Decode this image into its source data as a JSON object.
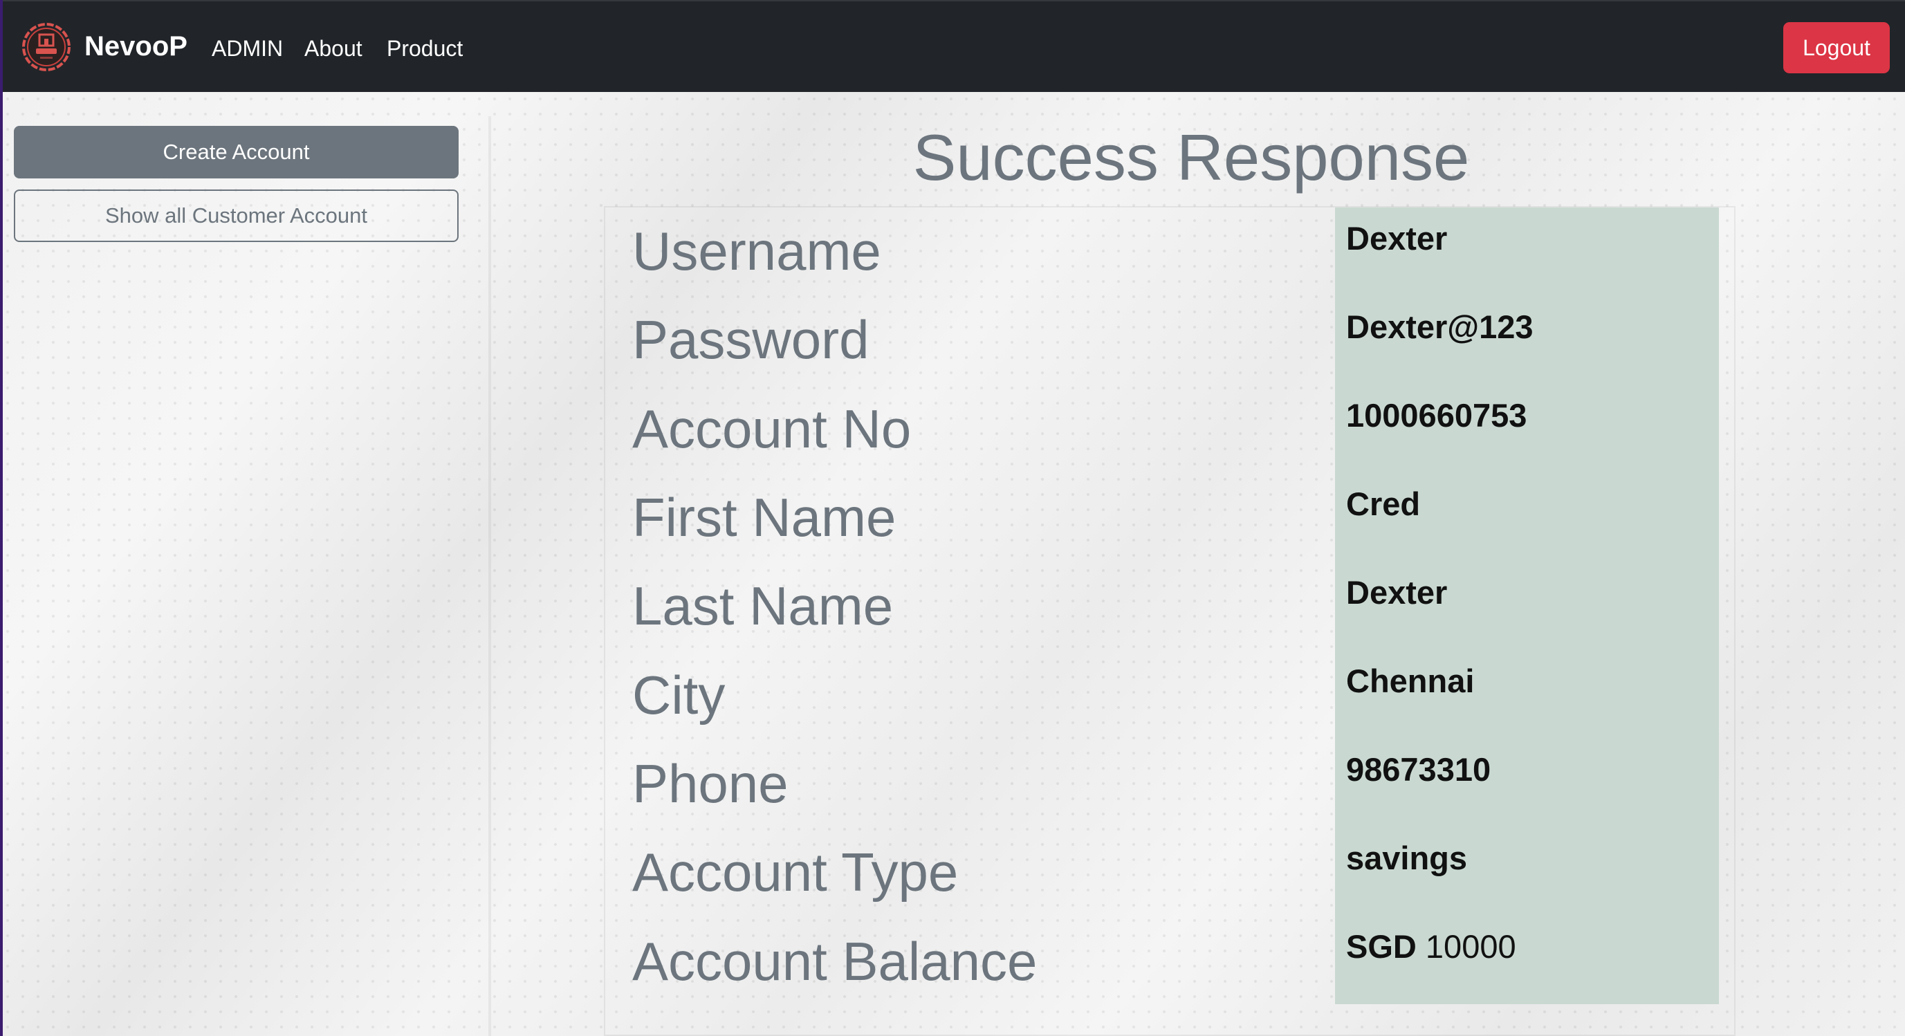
{
  "navbar": {
    "brand": "NevooP",
    "links": [
      "ADMIN",
      "About",
      "Product"
    ],
    "logout_label": "Logout",
    "logo_icon": "nevoop-logo-icon"
  },
  "sidebar": {
    "create_label": "Create Account",
    "show_label": "Show all Customer Account"
  },
  "main": {
    "title": "Success Response",
    "rows": [
      {
        "label": "Username",
        "value": "Dexter"
      },
      {
        "label": "Password",
        "value": "Dexter@123"
      },
      {
        "label": "Account No",
        "value": "1000660753"
      },
      {
        "label": "First Name",
        "value": "Cred"
      },
      {
        "label": "Last Name",
        "value": "Dexter"
      },
      {
        "label": "City",
        "value": "Chennai"
      },
      {
        "label": "Phone",
        "value": "98673310"
      },
      {
        "label": "Account Type",
        "value": "savings"
      },
      {
        "label": "Account Balance",
        "currency": "SGD",
        "value": "10000"
      }
    ]
  },
  "colors": {
    "navbar_bg": "#212529",
    "logout_bg": "#dc3545",
    "secondary": "#6c757d",
    "values_panel_bg": "#c9d9d1"
  }
}
